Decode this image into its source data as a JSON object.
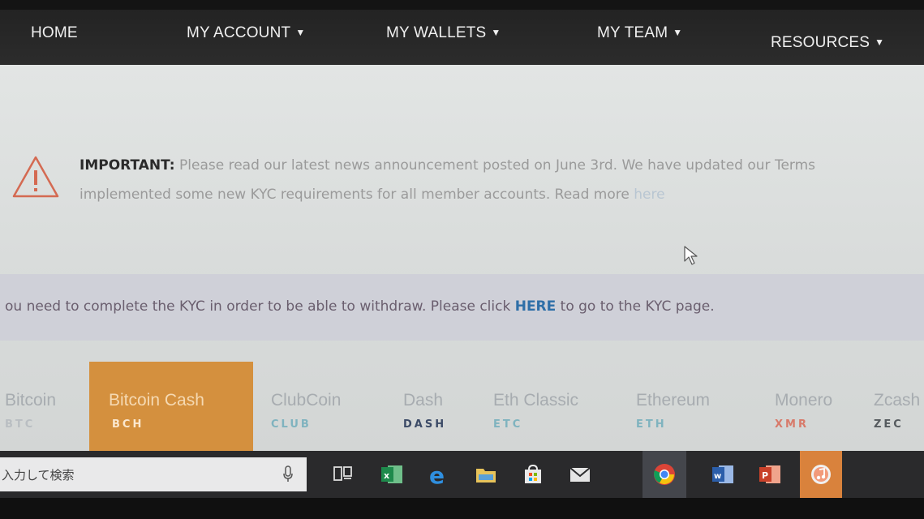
{
  "nav": {
    "items": [
      {
        "label": "HOME",
        "has_dropdown": false
      },
      {
        "label": "MY ACCOUNT",
        "has_dropdown": true
      },
      {
        "label": "MY WALLETS",
        "has_dropdown": true
      },
      {
        "label": "MY TEAM",
        "has_dropdown": true
      },
      {
        "label": "RESOURCES",
        "has_dropdown": true
      }
    ],
    "chevron_icon": "chevron-down-icon"
  },
  "notice": {
    "icon": "warning-triangle-icon",
    "icon_color": "#d46a52",
    "bold_label": "IMPORTANT:",
    "line1_text": " Please read our latest news announcement posted on June 3rd. We have updated our Terms",
    "line2_text": "implemented some new KYC requirements for all member accounts. Read more ",
    "line2_link": "here"
  },
  "kyc": {
    "text_before": "ou need to complete the KYC in order to be able to withdraw. Please click ",
    "link": "HERE",
    "text_after": " to go to the KYC page.",
    "link_color": "#2e6fa8"
  },
  "coin_tabs": [
    {
      "name": "Bitcoin",
      "code": "BTC",
      "code_color": "#b9bec2",
      "active": false
    },
    {
      "name": "Bitcoin Cash",
      "code": "BCH",
      "code_color": "#fbe8cf",
      "active": true
    },
    {
      "name": "ClubCoin",
      "code": "CLUB",
      "code_color": "#7fb3bf",
      "active": false
    },
    {
      "name": "Dash",
      "code": "DASH",
      "code_color": "#3b4a66",
      "active": false
    },
    {
      "name": "Eth Classic",
      "code": "ETC",
      "code_color": "#7fb3bf",
      "active": false
    },
    {
      "name": "Ethereum",
      "code": "ETH",
      "code_color": "#7fb3bf",
      "active": false
    },
    {
      "name": "Monero",
      "code": "XMR",
      "code_color": "#d87a6a",
      "active": false
    },
    {
      "name": "Zcash",
      "code": "ZEC",
      "code_color": "#555a5e",
      "active": false
    }
  ],
  "active_tab_color": "#d4903e",
  "taskbar": {
    "search_placeholder": "入力して検索",
    "icons": [
      "mic-icon",
      "task-view-icon",
      "excel-icon",
      "edge-icon",
      "file-explorer-icon",
      "store-icon",
      "mail-icon",
      "chrome-icon",
      "word-icon",
      "powerpoint-icon",
      "itunes-icon"
    ]
  }
}
